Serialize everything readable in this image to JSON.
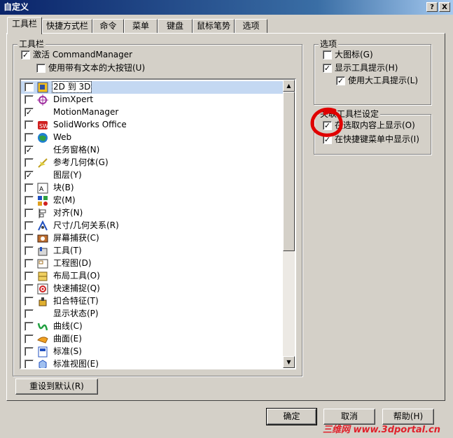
{
  "window": {
    "title": "自定义",
    "help_btn": "?",
    "close_btn": "X"
  },
  "tabs": [
    "工具栏",
    "快捷方式栏",
    "命令",
    "菜单",
    "键盘",
    "鼠标笔势",
    "选项"
  ],
  "toolbar_group": {
    "legend": "工具栏",
    "activate_cm": "激活 CommandManager",
    "activate_cm_checked": true,
    "large_buttons": "使用带有文本的大按钮(U)",
    "large_buttons_checked": false
  },
  "toolbar_list": [
    {
      "label": "2D 到 3D",
      "checked": false,
      "icon": "2d-to-3d-icon",
      "selected": true
    },
    {
      "label": "DimXpert",
      "checked": false,
      "icon": "dimxpert-icon"
    },
    {
      "label": "MotionManager",
      "checked": true,
      "icon": ""
    },
    {
      "label": "SolidWorks Office",
      "checked": false,
      "icon": "solidworks-office-icon"
    },
    {
      "label": "Web",
      "checked": false,
      "icon": "web-globe-icon"
    },
    {
      "label": "任务窗格(N)",
      "checked": true,
      "icon": ""
    },
    {
      "label": "参考几何体(G)",
      "checked": false,
      "icon": "reference-geometry-icon"
    },
    {
      "label": "图层(Y)",
      "checked": true,
      "icon": ""
    },
    {
      "label": "块(B)",
      "checked": false,
      "icon": "block-icon"
    },
    {
      "label": "宏(M)",
      "checked": false,
      "icon": "macro-icon"
    },
    {
      "label": "对齐(N)",
      "checked": false,
      "icon": "align-icon"
    },
    {
      "label": "尺寸/几何关系(R)",
      "checked": false,
      "icon": "dimension-relations-icon"
    },
    {
      "label": "屏幕捕获(C)",
      "checked": false,
      "icon": "screen-capture-icon"
    },
    {
      "label": "工具(T)",
      "checked": false,
      "icon": "tools-icon"
    },
    {
      "label": "工程图(D)",
      "checked": false,
      "icon": "drawing-icon"
    },
    {
      "label": "布局工具(O)",
      "checked": false,
      "icon": "layout-tools-icon"
    },
    {
      "label": "快速捕捉(Q)",
      "checked": false,
      "icon": "quick-snap-icon"
    },
    {
      "label": "扣合特征(T)",
      "checked": false,
      "icon": "fastening-features-icon"
    },
    {
      "label": "显示状态(P)",
      "checked": false,
      "icon": ""
    },
    {
      "label": "曲线(C)",
      "checked": false,
      "icon": "curves-icon"
    },
    {
      "label": "曲面(E)",
      "checked": false,
      "icon": "surfaces-icon"
    },
    {
      "label": "标准(S)",
      "checked": false,
      "icon": "standard-icon"
    },
    {
      "label": "标准视图(E)",
      "checked": false,
      "icon": "standard-views-icon"
    }
  ],
  "options_group": {
    "legend": "选项",
    "large_icons": "大图标(G)",
    "large_icons_checked": false,
    "show_tooltips": "显示工具提示(H)",
    "show_tooltips_checked": true,
    "large_tooltips": "使用大工具提示(L)",
    "large_tooltips_checked": true
  },
  "context_group": {
    "legend": "关联工具栏设定",
    "show_on_selection": "在选取内容上显示(O)",
    "show_on_selection_checked": true,
    "show_in_shortcut": "在快捷键菜单中显示(I)",
    "show_in_shortcut_checked": true
  },
  "buttons": {
    "reset": "重设到默认(R)",
    "ok": "确定",
    "cancel": "取消",
    "help": "帮助(H)"
  },
  "watermark": "三维网 www.3dportal.cn",
  "colors": {
    "title_bar": "#0a246a",
    "face": "#d4d0c8",
    "annotation_circle": "#e00000",
    "watermark": "#e0202a"
  }
}
